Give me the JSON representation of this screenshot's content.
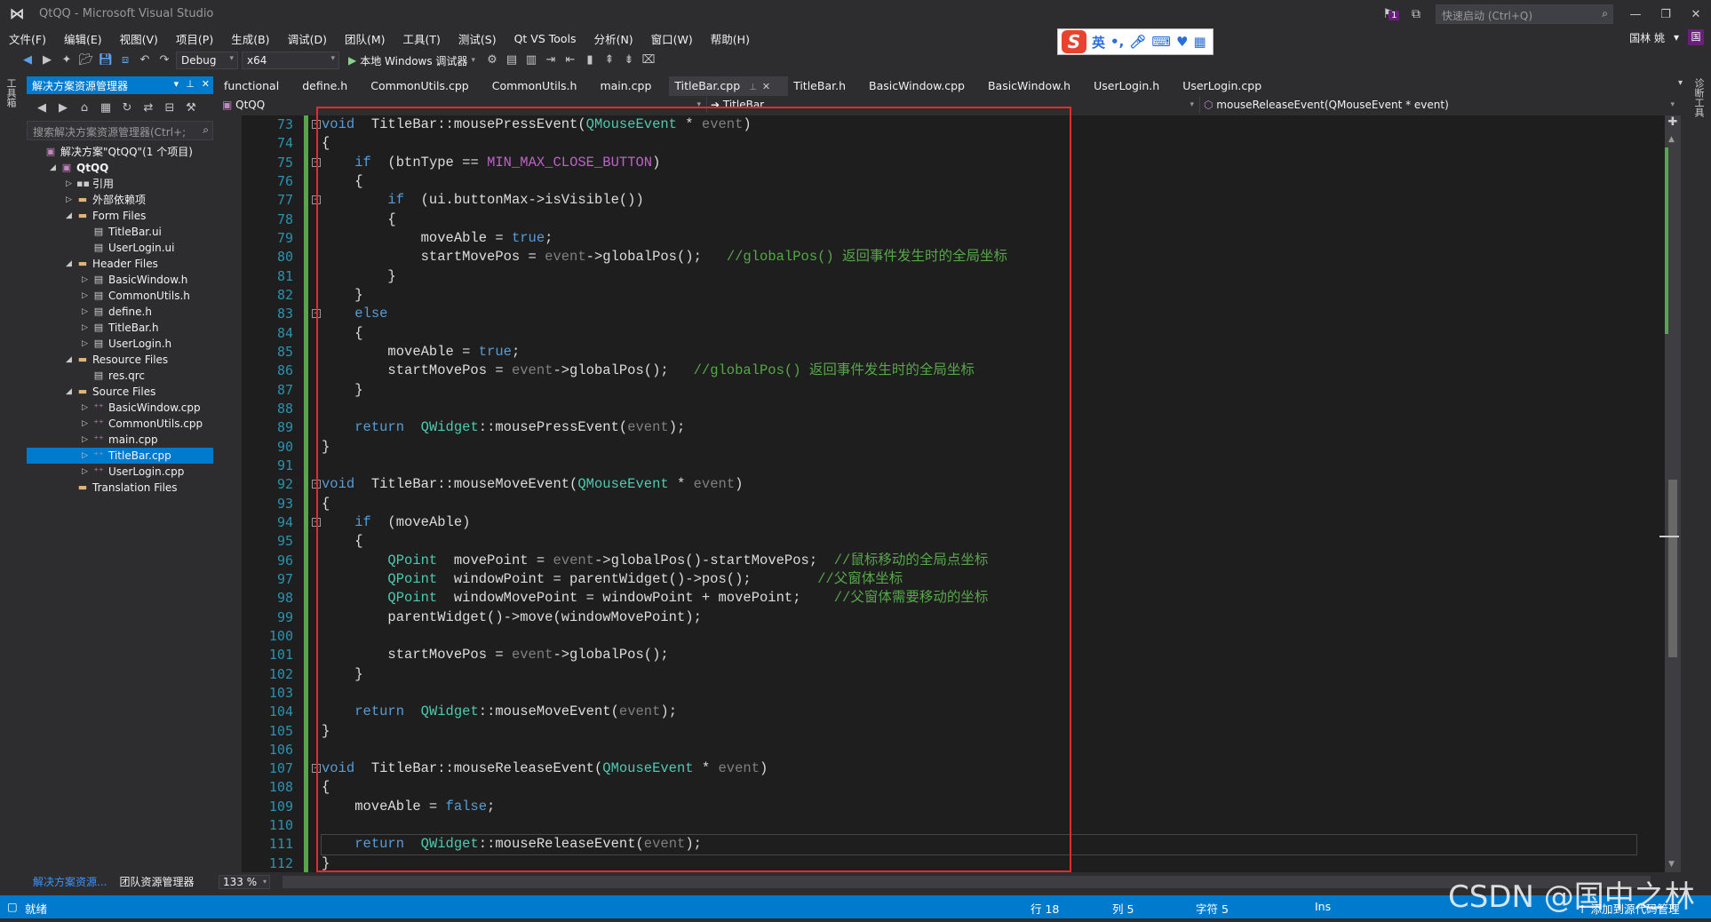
{
  "window": {
    "title": "QtQQ - Microsoft Visual Studio",
    "notification_count": "1",
    "quick_launch_placeholder": "快速启动 (Ctrl+Q)",
    "user_name": "国林 姚",
    "avatar_text": "国"
  },
  "menu": [
    "文件(F)",
    "编辑(E)",
    "视图(V)",
    "项目(P)",
    "生成(B)",
    "调试(D)",
    "团队(M)",
    "工具(T)",
    "测试(S)",
    "Qt VS Tools",
    "分析(N)",
    "窗口(W)",
    "帮助(H)"
  ],
  "ime": {
    "lang": "英"
  },
  "toolbar": {
    "config": "Debug",
    "platform": "x64",
    "run_label": "本地 Windows 调试器"
  },
  "left_strip": {
    "label": "工具箱"
  },
  "right_strip": {
    "label": "诊断工具"
  },
  "solution_explorer": {
    "title": "解决方案资源管理器",
    "search_placeholder": "搜索解决方案资源管理器(Ctrl+;",
    "tree": [
      {
        "label": "解决方案\"QtQQ\"(1 个项目)",
        "depth": 0,
        "icon": "solution",
        "expander": ""
      },
      {
        "label": "QtQQ",
        "depth": 1,
        "icon": "project",
        "expander": "open",
        "bold": true
      },
      {
        "label": "引用",
        "depth": 2,
        "icon": "references",
        "expander": "closed"
      },
      {
        "label": "外部依赖项",
        "depth": 2,
        "icon": "folder",
        "expander": "closed"
      },
      {
        "label": "Form Files",
        "depth": 2,
        "icon": "folder",
        "expander": "open"
      },
      {
        "label": "TitleBar.ui",
        "depth": 3,
        "icon": "file",
        "expander": ""
      },
      {
        "label": "UserLogin.ui",
        "depth": 3,
        "icon": "file",
        "expander": ""
      },
      {
        "label": "Header Files",
        "depth": 2,
        "icon": "folder",
        "expander": "open"
      },
      {
        "label": "BasicWindow.h",
        "depth": 3,
        "icon": "file",
        "expander": "closed"
      },
      {
        "label": "CommonUtils.h",
        "depth": 3,
        "icon": "file",
        "expander": "closed"
      },
      {
        "label": "define.h",
        "depth": 3,
        "icon": "file",
        "expander": "closed"
      },
      {
        "label": "TitleBar.h",
        "depth": 3,
        "icon": "file",
        "expander": "closed"
      },
      {
        "label": "UserLogin.h",
        "depth": 3,
        "icon": "file",
        "expander": "closed"
      },
      {
        "label": "Resource Files",
        "depth": 2,
        "icon": "folder",
        "expander": "open"
      },
      {
        "label": "res.qrc",
        "depth": 3,
        "icon": "file",
        "expander": ""
      },
      {
        "label": "Source Files",
        "depth": 2,
        "icon": "folder",
        "expander": "open"
      },
      {
        "label": "BasicWindow.cpp",
        "depth": 3,
        "icon": "cpp",
        "expander": "closed"
      },
      {
        "label": "CommonUtils.cpp",
        "depth": 3,
        "icon": "cpp",
        "expander": "closed"
      },
      {
        "label": "main.cpp",
        "depth": 3,
        "icon": "cpp",
        "expander": "closed"
      },
      {
        "label": "TitleBar.cpp",
        "depth": 3,
        "icon": "cpp",
        "expander": "closed",
        "selected": true
      },
      {
        "label": "UserLogin.cpp",
        "depth": 3,
        "icon": "cpp",
        "expander": "closed"
      },
      {
        "label": "Translation Files",
        "depth": 2,
        "icon": "folder",
        "expander": ""
      }
    ],
    "bottom_tabs": [
      "解决方案资源...",
      "团队资源管理器"
    ]
  },
  "editor": {
    "tabs": [
      {
        "label": "functional",
        "active": false
      },
      {
        "label": "define.h",
        "active": false
      },
      {
        "label": "CommonUtils.cpp",
        "active": false
      },
      {
        "label": "CommonUtils.h",
        "active": false
      },
      {
        "label": "main.cpp",
        "active": false
      },
      {
        "label": "TitleBar.cpp",
        "active": true
      },
      {
        "label": "TitleBar.h",
        "active": false
      },
      {
        "label": "BasicWindow.cpp",
        "active": false
      },
      {
        "label": "BasicWindow.h",
        "active": false
      },
      {
        "label": "UserLogin.h",
        "active": false
      },
      {
        "label": "UserLogin.cpp",
        "active": false
      }
    ],
    "nav": {
      "project": "QtQQ",
      "scope": "TitleBar",
      "member": "mouseReleaseEvent(QMouseEvent * event)"
    },
    "zoom": "133 %",
    "first_line": 73,
    "current_line": 111,
    "lines": [
      [
        [
          "kw",
          "void"
        ],
        [
          "",
          "  TitleBar::mousePressEvent("
        ],
        [
          "ty",
          "QMouseEvent"
        ],
        [
          "",
          " * "
        ],
        [
          "pr",
          "event"
        ],
        [
          "",
          ")"
        ]
      ],
      [
        [
          "",
          "{"
        ]
      ],
      [
        [
          "",
          "    "
        ],
        [
          "kw",
          "if"
        ],
        [
          "",
          "  (btnType == "
        ],
        [
          "mac",
          "MIN_MAX_CLOSE_BUTTON"
        ],
        [
          "",
          ")"
        ]
      ],
      [
        [
          "",
          "    {"
        ]
      ],
      [
        [
          "",
          "        "
        ],
        [
          "kw",
          "if"
        ],
        [
          "",
          "  (ui.buttonMax->isVisible())"
        ]
      ],
      [
        [
          "",
          "        {"
        ]
      ],
      [
        [
          "",
          "            moveAble = "
        ],
        [
          "kw",
          "true"
        ],
        [
          "",
          ";"
        ]
      ],
      [
        [
          "",
          "            startMovePos = "
        ],
        [
          "pr",
          "event"
        ],
        [
          "",
          "->globalPos();   "
        ],
        [
          "cm",
          "//globalPos() 返回事件发生时的全局坐标"
        ]
      ],
      [
        [
          "",
          "        }"
        ]
      ],
      [
        [
          "",
          "    }"
        ]
      ],
      [
        [
          "",
          "    "
        ],
        [
          "kw",
          "else"
        ]
      ],
      [
        [
          "",
          "    {"
        ]
      ],
      [
        [
          "",
          "        moveAble = "
        ],
        [
          "kw",
          "true"
        ],
        [
          "",
          ";"
        ]
      ],
      [
        [
          "",
          "        startMovePos = "
        ],
        [
          "pr",
          "event"
        ],
        [
          "",
          "->globalPos();   "
        ],
        [
          "cm",
          "//globalPos() 返回事件发生时的全局坐标"
        ]
      ],
      [
        [
          "",
          "    }"
        ]
      ],
      [
        [
          "",
          ""
        ]
      ],
      [
        [
          "",
          "    "
        ],
        [
          "kw",
          "return"
        ],
        [
          "",
          "  "
        ],
        [
          "ty",
          "QWidget"
        ],
        [
          "",
          "::mousePressEvent("
        ],
        [
          "pr",
          "event"
        ],
        [
          "",
          ");"
        ]
      ],
      [
        [
          "",
          "}"
        ]
      ],
      [
        [
          "",
          ""
        ]
      ],
      [
        [
          "kw",
          "void"
        ],
        [
          "",
          "  TitleBar::mouseMoveEvent("
        ],
        [
          "ty",
          "QMouseEvent"
        ],
        [
          "",
          " * "
        ],
        [
          "pr",
          "event"
        ],
        [
          "",
          ")"
        ]
      ],
      [
        [
          "",
          "{"
        ]
      ],
      [
        [
          "",
          "    "
        ],
        [
          "kw",
          "if"
        ],
        [
          "",
          "  (moveAble)"
        ]
      ],
      [
        [
          "",
          "    {"
        ]
      ],
      [
        [
          "",
          "        "
        ],
        [
          "ty",
          "QPoint"
        ],
        [
          "",
          "  movePoint = "
        ],
        [
          "pr",
          "event"
        ],
        [
          "",
          "->globalPos()-startMovePos;  "
        ],
        [
          "cm",
          "//鼠标移动的全局点坐标"
        ]
      ],
      [
        [
          "",
          "        "
        ],
        [
          "ty",
          "QPoint"
        ],
        [
          "",
          "  windowPoint = parentWidget()->pos();        "
        ],
        [
          "cm",
          "//父窗体坐标"
        ]
      ],
      [
        [
          "",
          "        "
        ],
        [
          "ty",
          "QPoint"
        ],
        [
          "",
          "  windowMovePoint = windowPoint + movePoint;    "
        ],
        [
          "cm",
          "//父窗体需要移动的坐标"
        ]
      ],
      [
        [
          "",
          "        parentWidget()->move(windowMovePoint);"
        ]
      ],
      [
        [
          "",
          ""
        ]
      ],
      [
        [
          "",
          "        startMovePos = "
        ],
        [
          "pr",
          "event"
        ],
        [
          "",
          "->globalPos();"
        ]
      ],
      [
        [
          "",
          "    }"
        ]
      ],
      [
        [
          "",
          ""
        ]
      ],
      [
        [
          "",
          "    "
        ],
        [
          "kw",
          "return"
        ],
        [
          "",
          "  "
        ],
        [
          "ty",
          "QWidget"
        ],
        [
          "",
          "::mouseMoveEvent("
        ],
        [
          "pr",
          "event"
        ],
        [
          "",
          ");"
        ]
      ],
      [
        [
          "",
          "}"
        ]
      ],
      [
        [
          "",
          ""
        ]
      ],
      [
        [
          "kw",
          "void"
        ],
        [
          "",
          "  TitleBar::mouseReleaseEvent("
        ],
        [
          "ty",
          "QMouseEvent"
        ],
        [
          "",
          " * "
        ],
        [
          "pr",
          "event"
        ],
        [
          "",
          ")"
        ]
      ],
      [
        [
          "",
          "{"
        ]
      ],
      [
        [
          "",
          "    moveAble = "
        ],
        [
          "kw",
          "false"
        ],
        [
          "",
          ";"
        ]
      ],
      [
        [
          "",
          ""
        ]
      ],
      [
        [
          "",
          "    "
        ],
        [
          "kw",
          "return"
        ],
        [
          "",
          "  "
        ],
        [
          "ty",
          "QWidget"
        ],
        [
          "",
          "::mouseReleaseEvent("
        ],
        [
          "pr",
          "event"
        ],
        [
          "",
          ");"
        ]
      ],
      [
        [
          "",
          "}"
        ]
      ]
    ],
    "folds": [
      73,
      75,
      77,
      83,
      92,
      94,
      107
    ]
  },
  "status": {
    "state": "就绪",
    "row": "行 18",
    "col": "列 5",
    "char": "字符 5",
    "mode": "Ins",
    "source_control": "↑ 添加到源代码管理"
  },
  "watermark": "CSDN @国中之林"
}
